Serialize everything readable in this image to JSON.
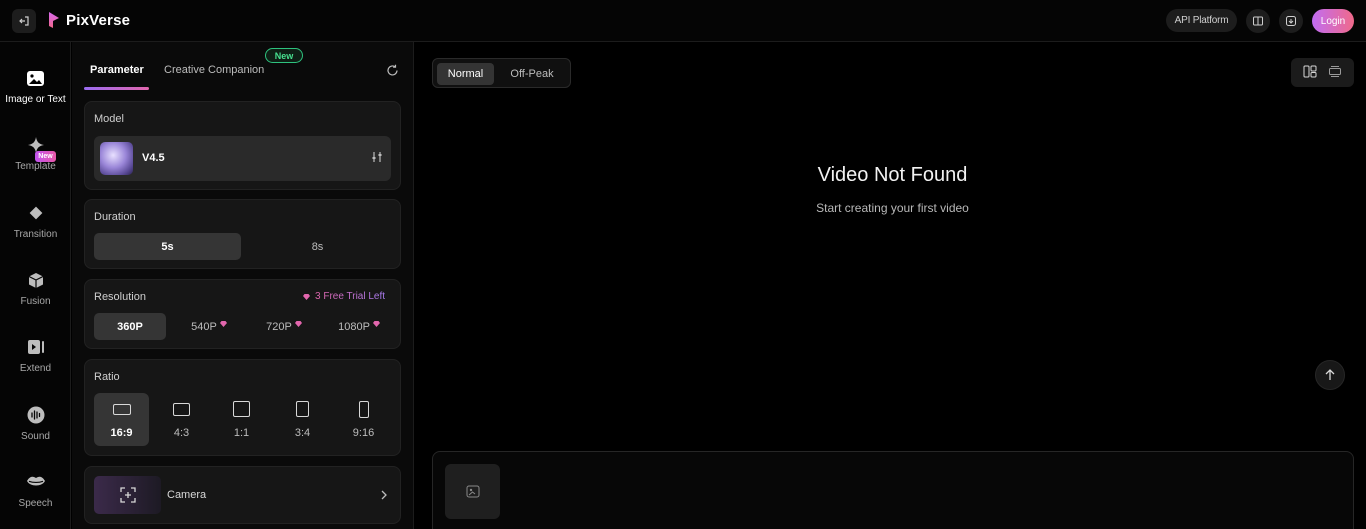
{
  "header": {
    "logo_text": "PixVerse",
    "api_platform_label": "API Platform",
    "login_label": "Login",
    "icons": [
      "exit-icon",
      "book-icon",
      "download-icon"
    ]
  },
  "nav": {
    "items": [
      {
        "label": "Image or Text",
        "icon": "image-icon",
        "active": true
      },
      {
        "label": "Template",
        "icon": "sparkle-icon"
      },
      {
        "label": "Transition",
        "icon": "diamond-icon",
        "badge": "New"
      },
      {
        "label": "Fusion",
        "icon": "cube-icon"
      },
      {
        "label": "Extend",
        "icon": "extend-icon"
      },
      {
        "label": "Sound",
        "icon": "sound-icon"
      },
      {
        "label": "Speech",
        "icon": "lips-icon"
      }
    ]
  },
  "panel": {
    "tabs": {
      "parameter": "Parameter",
      "creative": "Creative Companion",
      "new_badge": "New"
    },
    "model": {
      "title": "Model",
      "value": "V4.5"
    },
    "duration": {
      "title": "Duration",
      "options": [
        "5s",
        "8s"
      ],
      "selected": "5s"
    },
    "resolution": {
      "title": "Resolution",
      "trial_text": "3 Free Trial Left",
      "options": [
        "360P",
        "540P",
        "720P",
        "1080P"
      ],
      "selected": "360P"
    },
    "ratio": {
      "title": "Ratio",
      "options": [
        "16:9",
        "4:3",
        "1:1",
        "3:4",
        "9:16"
      ],
      "selected": "16:9"
    },
    "camera": {
      "label": "Camera"
    }
  },
  "main": {
    "modes": [
      "Normal",
      "Off-Peak"
    ],
    "selected_mode": "Normal",
    "empty_title": "Video Not Found",
    "empty_subtitle": "Start creating your first video"
  },
  "colors": {
    "accent_gradient_start": "#c16cf2",
    "accent_gradient_end": "#f06a8a",
    "new_green": "#47e08f"
  }
}
